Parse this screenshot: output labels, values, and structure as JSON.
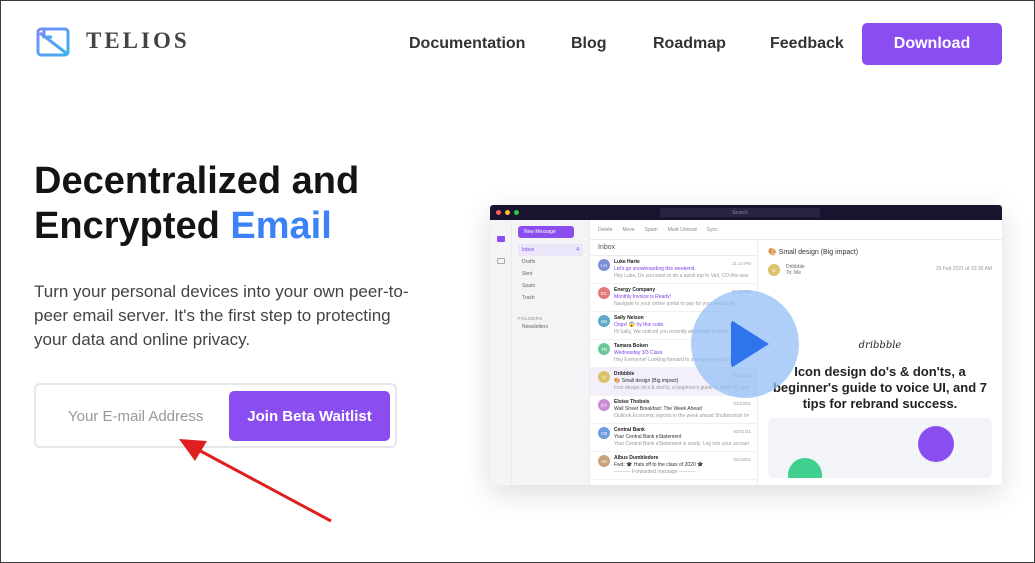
{
  "header": {
    "brand": "TELIOS",
    "nav": [
      "Documentation",
      "Blog",
      "Roadmap",
      "Feedback"
    ],
    "download_label": "Download"
  },
  "hero": {
    "title_line1": "Decentralized and",
    "title_line2_prefix": "Encrypted ",
    "title_line2_accent": "Email",
    "subtitle": "Turn your personal devices into your own peer-to-peer email server. It's the first step to protecting your data and online privacy.",
    "email_placeholder": "Your E-mail Address",
    "cta_label": "Join Beta Waitlist"
  },
  "app_preview": {
    "search_label": "Search",
    "new_message": "New Message",
    "folders": [
      {
        "label": "Inbox",
        "count": "4"
      },
      {
        "label": "Drafts",
        "count": ""
      },
      {
        "label": "Sent",
        "count": ""
      },
      {
        "label": "Spam",
        "count": ""
      },
      {
        "label": "Trash",
        "count": ""
      }
    ],
    "folders_heading": "FOLDERS",
    "custom_folder": "Newsletters",
    "toolbar": [
      "Delete",
      "Move",
      "Spam",
      "Mark Unread",
      "Sync"
    ],
    "list_title": "Inbox",
    "mails": [
      {
        "initials": "LH",
        "from": "Luke Harte",
        "subject": "Let's go snowboarding this weekend.",
        "preview": "Hey Luke, Do you want to do a quick trip to Vail, CO this weekend",
        "date": "11:14 PM",
        "color": "#7c8fd6",
        "unread": true
      },
      {
        "initials": "EC",
        "from": "Energy Company",
        "subject": "Monthly Invoice is Ready!",
        "preview": "Navigate to your online portal to pay for your electricity",
        "date": "03:12 PM",
        "color": "#e07a7a",
        "unread": true
      },
      {
        "initials": "SN",
        "from": "Sally Nelson",
        "subject": "Oops! 😱 try this code.",
        "preview": "Hi Sally, We noticed you recently attempted to order...",
        "date": "",
        "color": "#5fa8c9",
        "unread": true
      },
      {
        "initials": "TB",
        "from": "Tamara Boken",
        "subject": "Wednesday 3/3 Class",
        "preview": "Hey Everyone! Looking forward to seeing everyone in class",
        "date": "",
        "color": "#6cc79a",
        "unread": true
      },
      {
        "initials": "D",
        "from": "Dribbble",
        "subject": "🎨 Small design (Big impact)",
        "preview": "Icon design do's & don'ts, a beginner's guide to voice UI, and...",
        "date": "02/25/21",
        "color": "#d9c46a",
        "unread": false
      },
      {
        "initials": "ET",
        "from": "Eloise Thobois",
        "subject": "Wall Street Breakfast: The Week Ahead",
        "preview": "Outlook Economic reports in the week ahead Shutterstock Investors...",
        "date": "02/23/21",
        "color": "#c98bd6",
        "unread": false
      },
      {
        "initials": "CB",
        "from": "Central Bank",
        "subject": "Your Central Bank eStatement",
        "preview": "Your Central Bank eStatement is ready. Log into your account...",
        "date": "02/21/21",
        "color": "#6f9ce0",
        "unread": false
      },
      {
        "initials": "AD",
        "from": "Albus Dumbledore",
        "subject": "Fwd: 🎓 Hats off to the class of 2020 🎓",
        "preview": "---------- Forwarded message ----------",
        "date": "02/18/21",
        "color": "#c7a27a",
        "unread": false
      }
    ],
    "reader": {
      "subject": "🎨 Small design (Big impact)",
      "from": "Dribbble",
      "to": "To: Me",
      "date": "25 Feb 2021 at 10:30 AM",
      "logo": "dribbble",
      "headline": "Icon design do's & don'ts, a beginner's guide to voice UI, and 7 tips for rebrand success."
    }
  },
  "colors": {
    "brand": "#8a4ef0",
    "accent": "#3b82f6",
    "arrow": "#e02020"
  }
}
